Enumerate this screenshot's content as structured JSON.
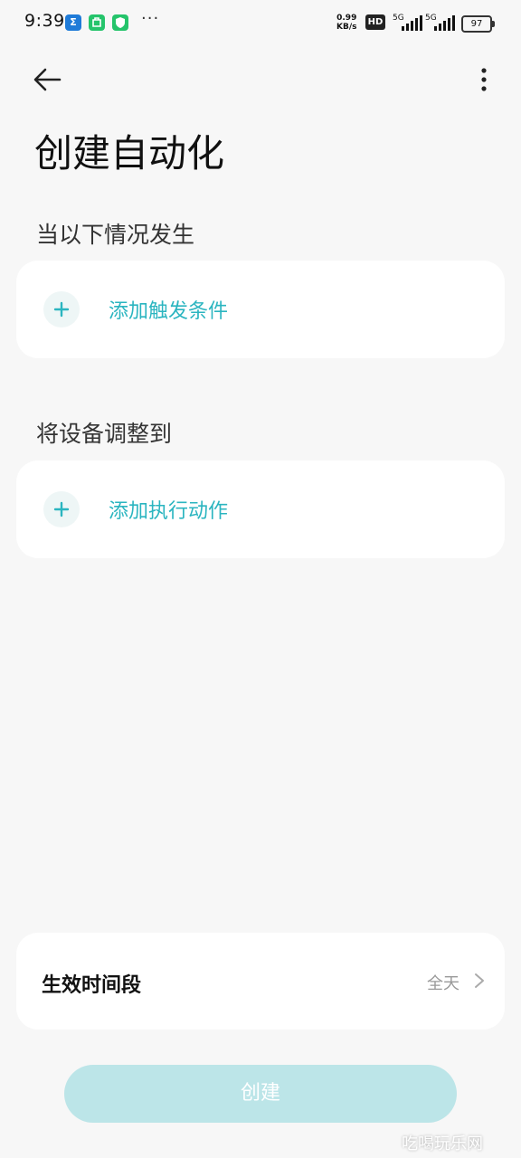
{
  "status_bar": {
    "time": "9:39",
    "more_dots": "···",
    "net_speed_value": "0.99",
    "net_speed_unit": "KB/s",
    "hd": "HD",
    "signal1_label": "5G",
    "signal2_label": "5G",
    "battery": "97"
  },
  "header": {
    "title": "创建自动化"
  },
  "trigger_section": {
    "label": "当以下情况发生",
    "add_label": "添加触发条件"
  },
  "action_section": {
    "label": "将设备调整到",
    "add_label": "添加执行动作"
  },
  "time_period": {
    "label": "生效时间段",
    "value": "全天"
  },
  "create_button": {
    "label": "创建"
  },
  "watermark": "吃喝玩乐网",
  "colors": {
    "accent": "#2bb5c0",
    "button_disabled": "#bce5e8",
    "background": "#f7f7f7"
  }
}
